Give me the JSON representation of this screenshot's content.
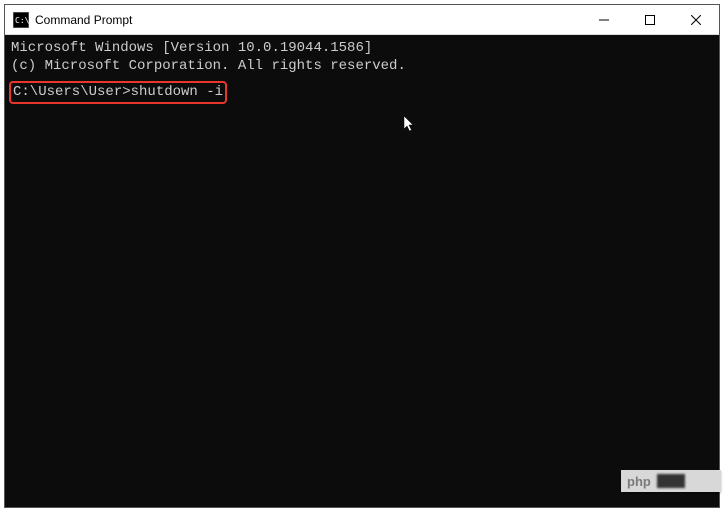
{
  "window": {
    "title": "Command Prompt"
  },
  "terminal": {
    "line1": "Microsoft Windows [Version 10.0.19044.1586]",
    "line2": "(c) Microsoft Corporation. All rights reserved.",
    "prompt": "C:\\Users\\User>",
    "command": "shutdown -i"
  },
  "watermark": {
    "text": "php"
  }
}
